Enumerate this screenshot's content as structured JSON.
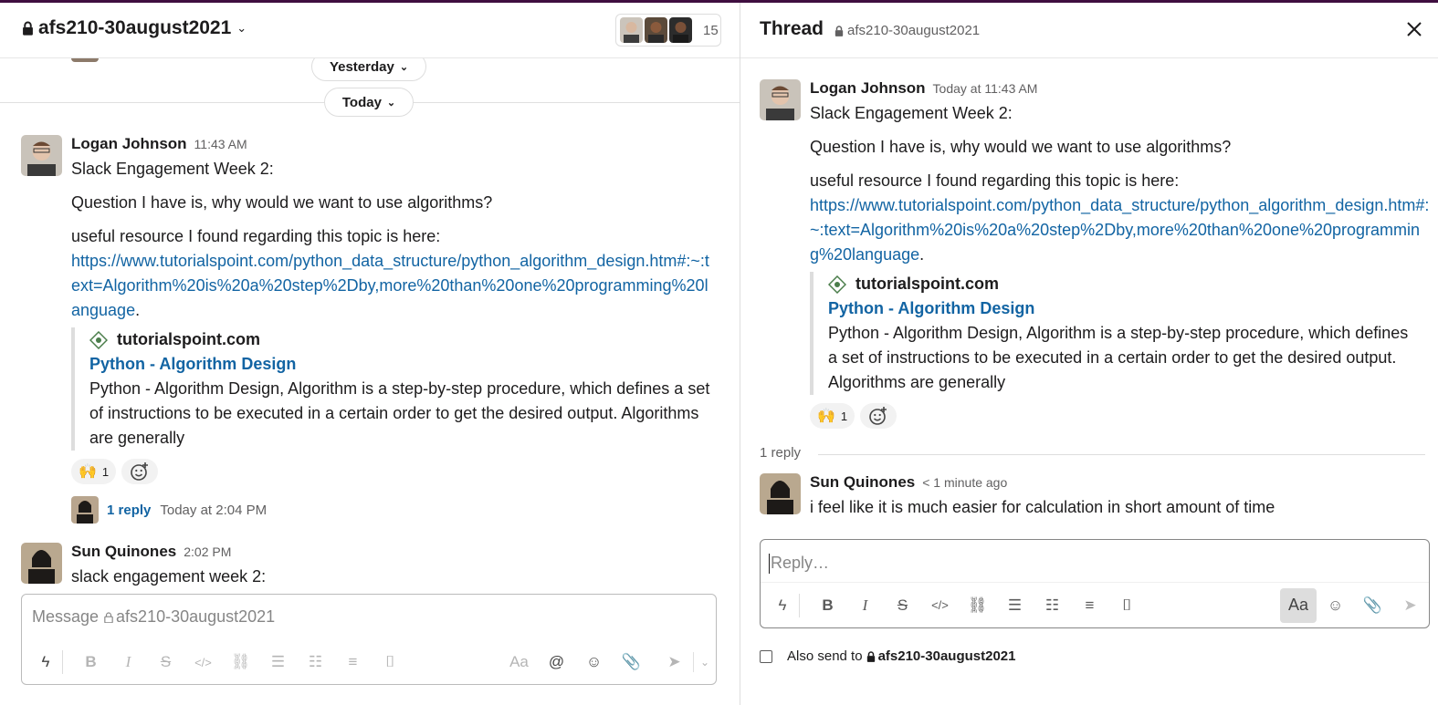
{
  "channel": {
    "name": "afs210-30august2021",
    "member_count": "15"
  },
  "dividers": {
    "yesterday": "Yesterday",
    "today": "Today"
  },
  "messages": [
    {
      "author": "Logan Johnson",
      "time": "11:43 AM",
      "lines": [
        "Slack Engagement Week 2:",
        "Question I have is, why would we want to use algorithms?",
        "useful resource I found regarding this topic is here:"
      ],
      "link": "https://www.tutorialspoint.com/python_data_structure/python_algorithm_design.htm#:~:text=Algorithm%20is%20a%20step%2Dby,more%20than%20one%20programming%20language",
      "link_suffix": ".",
      "unfurl": {
        "site": "tutorialspoint.com",
        "title": "Python - Algorithm Design",
        "description": "Python - Algorithm Design, Algorithm is a step-by-step procedure, which defines a set of instructions to be executed in a certain order to get the desired output. Algorithms are generally"
      },
      "reaction": {
        "emoji": "🙌",
        "count": "1"
      },
      "replies": {
        "label": "1 reply",
        "time": "Today at 2:04 PM"
      }
    },
    {
      "author": "Sun Quinones",
      "time": "2:02 PM",
      "text": "slack engagement week 2:"
    }
  ],
  "composer": {
    "placeholder_prefix": "Message",
    "placeholder_channel": "afs210-30august2021",
    "format_label": "Aa",
    "mention_label": "@"
  },
  "thread": {
    "title": "Thread",
    "channel": "afs210-30august2021",
    "parent_time": "Today at 11:43 AM",
    "reply_count": "1 reply",
    "reply": {
      "author": "Sun Quinones",
      "time": "< 1 minute ago",
      "text": "i feel like it is much easier for calculation  in short amount of time"
    },
    "reply_placeholder": "Reply…",
    "also_send_label": "Also send to",
    "also_send_channel": "afs210-30august2021"
  },
  "colors": {
    "link": "#1264a3",
    "aubergine": "#3f0e40",
    "muted": "#616061"
  }
}
